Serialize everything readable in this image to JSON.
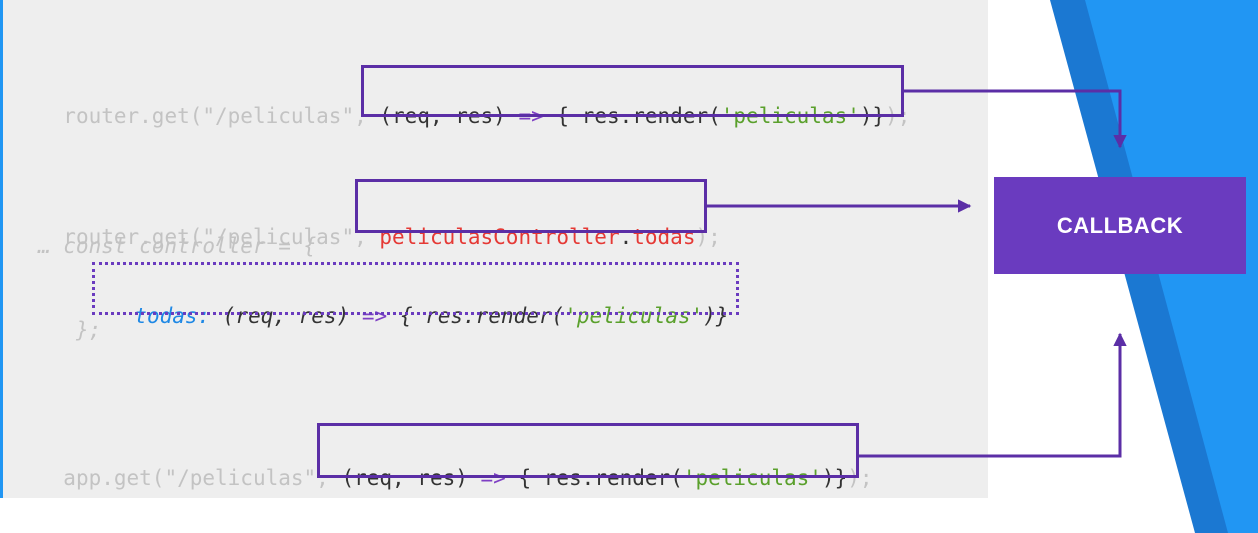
{
  "colors": {
    "panel_bg": "#eeeeee",
    "accent_blue": "#2196f3",
    "deco_blue_dark": "#1b78d2",
    "deco_blue_light": "#2196f3",
    "box_purple": "#5b2ea6",
    "callback_purple": "#6a3bbf",
    "string_green": "#5aa02c",
    "method_red": "#e53935",
    "property_blue": "#1e88e5"
  },
  "line1": {
    "prefix": "router.get(\"/peliculas\", ",
    "open": "(req, res) ",
    "arrow": "=>",
    "mid": " { res.render(",
    "str": "'peliculas'",
    "close": ")}",
    "suffix": ");"
  },
  "line2": {
    "prefix": "router.get(\"/peliculas\", ",
    "controller": "peliculasController",
    "dot": ".",
    "method": "todas",
    "suffix": ");"
  },
  "line3": {
    "text": "… const controller = {"
  },
  "line4": {
    "prop": "todas:",
    "open": " (req, res) ",
    "arrow": "=>",
    "mid": " { res.render(",
    "str": "'peliculas'",
    "close": ")}"
  },
  "line5": {
    "text": "};"
  },
  "line6": {
    "prefix": "app.get(\"/peliculas\", ",
    "open": "(req, res) ",
    "arrow": "=>",
    "mid": " { res.render(",
    "str": "'peliculas'",
    "close": ")}",
    "suffix": ");"
  },
  "callback_label": "CALLBACK"
}
